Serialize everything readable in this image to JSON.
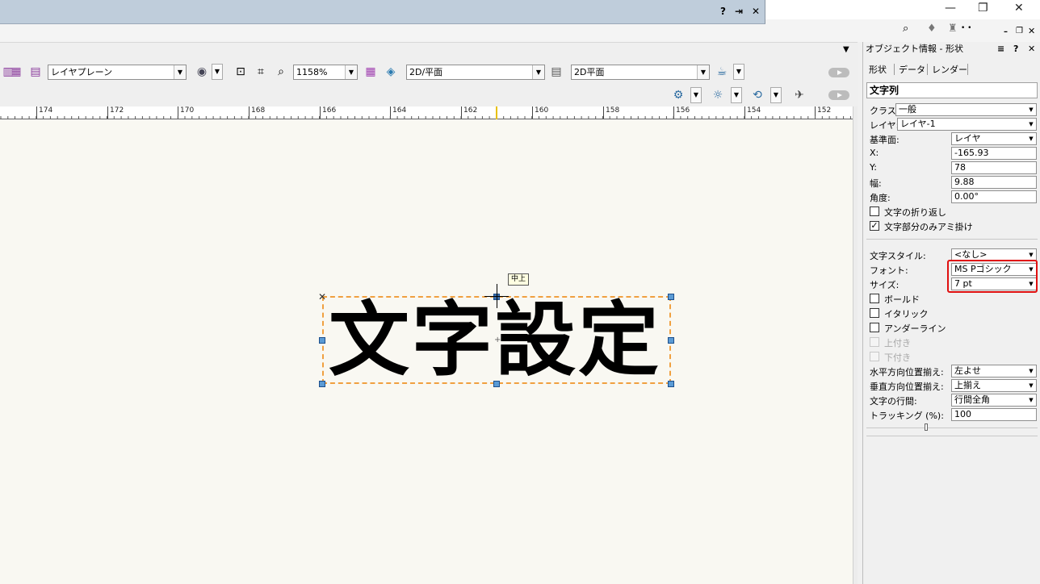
{
  "inner_window": {
    "help_btn": "?",
    "pin_btn": "⇥",
    "close_btn": "✕"
  },
  "app_window": {
    "minimize": "—",
    "restore": "❐",
    "close": "✕",
    "dots": "• •"
  },
  "toolbar": {
    "layer_plane": "レイヤプレーン",
    "zoom": "1158%",
    "view": "2D/平面",
    "plane": "2D平面"
  },
  "ruler": {
    "labels": [
      "174",
      "172",
      "170",
      "168",
      "166",
      "164",
      "162",
      "160",
      "158",
      "156",
      "154",
      "152"
    ]
  },
  "canvas": {
    "text_object": "文字設定",
    "tooltip": "中上"
  },
  "panel": {
    "title": "オブジェクト情報 - 形状",
    "title_menu": "≡",
    "title_help": "?",
    "title_close": "✕",
    "tabs": [
      "形状",
      "データ",
      "レンダー"
    ],
    "section": "文字列",
    "class_label": "クラス:",
    "class_value": "一般",
    "layer_label": "レイヤ:",
    "layer_value": "レイヤ-1",
    "base_label": "基準面:",
    "base_value": "レイヤ",
    "x_label": "X:",
    "x_value": "-165.93",
    "y_label": "Y:",
    "y_value": "78",
    "width_label": "幅:",
    "width_value": "9.88",
    "angle_label": "角度:",
    "angle_value": "0.00°",
    "wrap_label": "文字の折り返し",
    "wrap_checked": "",
    "hatch_label": "文字部分のみアミ掛け",
    "hatch_checked": "✓",
    "style_label": "文字スタイル:",
    "style_value": "<なし>",
    "font_label": "フォント:",
    "font_value": "MS Pゴシック",
    "size_label": "サイズ:",
    "size_value": "7 pt",
    "bold_label": "ボールド",
    "italic_label": "イタリック",
    "underline_label": "アンダーライン",
    "super_label": "上付き",
    "sub_label": "下付き",
    "halign_label": "水平方向位置揃え:",
    "halign_value": "左よせ",
    "valign_label": "垂直方向位置揃え:",
    "valign_value": "上揃え",
    "spacing_label": "文字の行間:",
    "spacing_value": "行間全角",
    "tracking_label": "トラッキング (%):",
    "tracking_value": "100"
  },
  "colors": {
    "highlight": "#e01010",
    "selection_dash": "#f0a040",
    "handle": "#5b9bd5"
  }
}
